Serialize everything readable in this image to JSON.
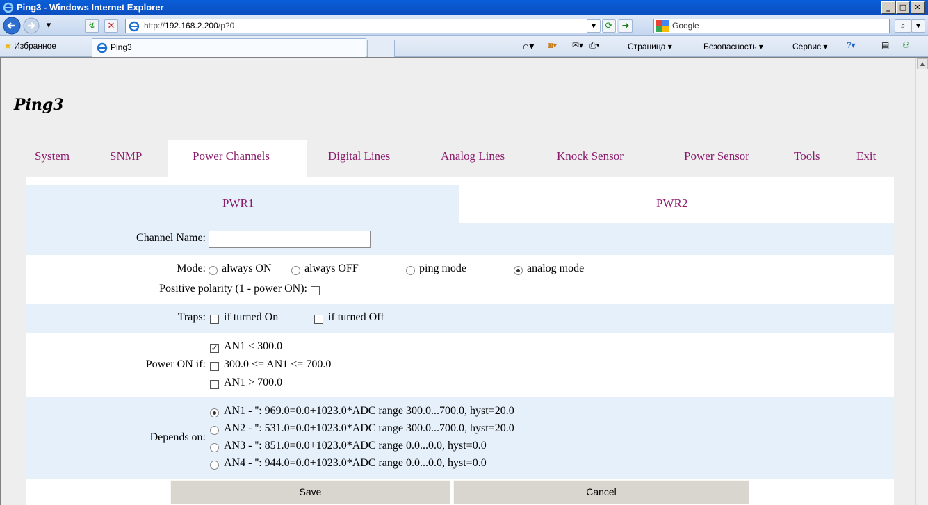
{
  "window": {
    "title": "Ping3 - Windows Internet Explorer"
  },
  "address_bar": {
    "url_prefix": "http://",
    "url_host": "192.168.2.200",
    "url_path": "/p?0",
    "search_placeholder": "Google"
  },
  "favorites_bar": {
    "favorites_label": "Избранное",
    "tab_label": "Ping3",
    "commands": [
      "Страница ▾",
      "Безопасность ▾",
      "Сервис ▾"
    ]
  },
  "page": {
    "app_title": "Ping3",
    "menu": [
      {
        "label": "System"
      },
      {
        "label": "SNMP"
      },
      {
        "label": "Power Channels"
      },
      {
        "label": "Digital Lines"
      },
      {
        "label": "Analog Lines"
      },
      {
        "label": "Knock Sensor"
      },
      {
        "label": "Power Sensor"
      },
      {
        "label": "Tools"
      },
      {
        "label": "Exit"
      }
    ],
    "subtabs": [
      {
        "label": "PWR1"
      },
      {
        "label": "PWR2"
      }
    ],
    "channel_name_label": "Channel Name:",
    "channel_name_value": "",
    "mode_label": "Mode:",
    "mode_options": [
      {
        "label": "always ON",
        "checked": false
      },
      {
        "label": "always OFF",
        "checked": false
      },
      {
        "label": "ping mode",
        "checked": false
      },
      {
        "label": "analog mode",
        "checked": true
      }
    ],
    "polarity_label": "Positive polarity (1 - power ON):",
    "polarity_checked": false,
    "traps_label": "Traps:",
    "traps": [
      {
        "label": "if turned On",
        "checked": false
      },
      {
        "label": "if turned Off",
        "checked": false
      }
    ],
    "power_on_label": "Power ON if:",
    "power_on_conditions": [
      {
        "label": "AN1 < 300.0",
        "checked": true
      },
      {
        "label": "300.0 <= AN1 <= 700.0",
        "checked": false
      },
      {
        "label": "AN1 > 700.0",
        "checked": false
      }
    ],
    "depends_label": "Depends on:",
    "depends_options": [
      {
        "label": "AN1 - '': 969.0=0.0+1023.0*ADC range 300.0...700.0, hyst=20.0",
        "checked": true
      },
      {
        "label": "AN2 - '': 531.0=0.0+1023.0*ADC range 300.0...700.0, hyst=20.0",
        "checked": false
      },
      {
        "label": "AN3 - '': 851.0=0.0+1023.0*ADC range 0.0...0.0, hyst=0.0",
        "checked": false
      },
      {
        "label": "AN4 - '': 944.0=0.0+1023.0*ADC range 0.0...0.0, hyst=0.0",
        "checked": false
      }
    ],
    "save_label": "Save",
    "cancel_label": "Cancel"
  }
}
